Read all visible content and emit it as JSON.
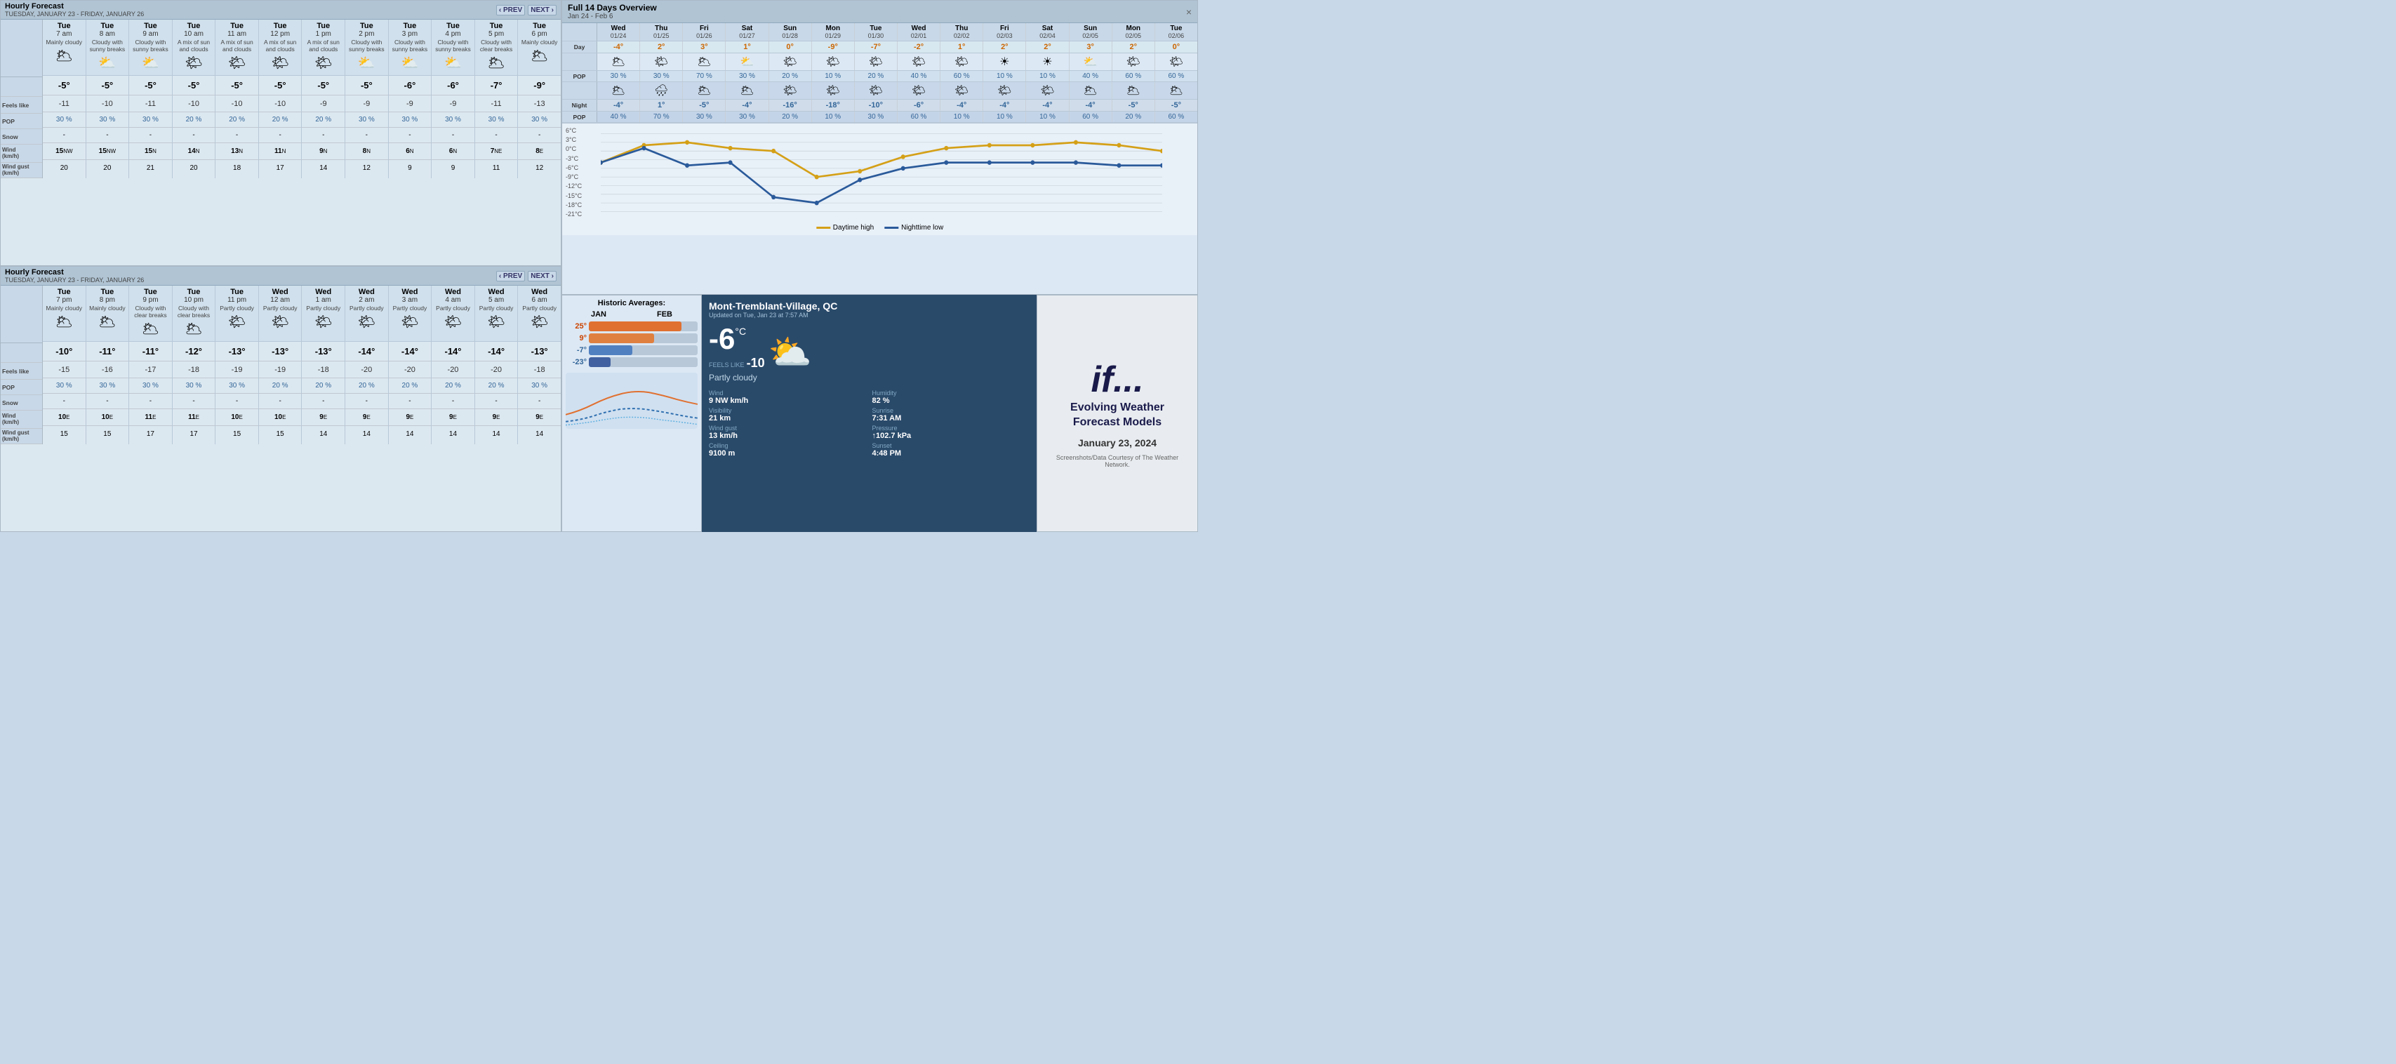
{
  "top_left": {
    "title": "Hourly Forecast",
    "subtitle": "TUESDAY, JANUARY 23 - FRIDAY, JANUARY 26",
    "prev": "‹ PREV",
    "next": "NEXT ›",
    "side_labels": [
      {
        "text": "",
        "type": "spacer"
      },
      {
        "text": "Feels like",
        "type": "feels"
      },
      {
        "text": "POP",
        "type": "pop"
      },
      {
        "text": "Snow",
        "type": "snow"
      },
      {
        "text": "Wind (km/h)",
        "type": "wind"
      },
      {
        "text": "Wind gust (km/h)",
        "type": "gust"
      }
    ],
    "hours": [
      {
        "day": "Tue",
        "time": "7 am",
        "desc": "Mainly cloudy",
        "icon": "🌥",
        "temp": "-5°",
        "feels": "-11",
        "pop": "30",
        "snow": "-",
        "wind": "15",
        "wind_dir": "NW",
        "gust": "20"
      },
      {
        "day": "Tue",
        "time": "8 am",
        "desc": "Cloudy with sunny breaks",
        "icon": "⛅",
        "temp": "-5°",
        "feels": "-10",
        "pop": "30",
        "snow": "-",
        "wind": "15",
        "wind_dir": "NW",
        "gust": "20"
      },
      {
        "day": "Tue",
        "time": "9 am",
        "desc": "Cloudy with sunny breaks",
        "icon": "⛅",
        "temp": "-5°",
        "feels": "-11",
        "pop": "30",
        "snow": "-",
        "wind": "15",
        "wind_dir": "N",
        "gust": "21"
      },
      {
        "day": "Tue",
        "time": "10 am",
        "desc": "A mix of sun and clouds",
        "icon": "🌤",
        "temp": "-5°",
        "feels": "-10",
        "pop": "20",
        "snow": "-",
        "wind": "14",
        "wind_dir": "N",
        "gust": "20"
      },
      {
        "day": "Tue",
        "time": "11 am",
        "desc": "A mix of sun and clouds",
        "icon": "🌤",
        "temp": "-5°",
        "feels": "-10",
        "pop": "20",
        "snow": "-",
        "wind": "13",
        "wind_dir": "N",
        "gust": "18"
      },
      {
        "day": "Tue",
        "time": "12 pm",
        "desc": "A mix of sun and clouds",
        "icon": "🌤",
        "temp": "-5°",
        "feels": "-10",
        "pop": "20",
        "snow": "-",
        "wind": "11",
        "wind_dir": "N",
        "gust": "17"
      },
      {
        "day": "Tue",
        "time": "1 pm",
        "desc": "A mix of sun and clouds",
        "icon": "🌤",
        "temp": "-5°",
        "feels": "-9",
        "pop": "20",
        "snow": "-",
        "wind": "9",
        "wind_dir": "N",
        "gust": "14"
      },
      {
        "day": "Tue",
        "time": "2 pm",
        "desc": "Cloudy with sunny breaks",
        "icon": "⛅",
        "temp": "-5°",
        "feels": "-9",
        "pop": "30",
        "snow": "-",
        "wind": "8",
        "wind_dir": "N",
        "gust": "12"
      },
      {
        "day": "Tue",
        "time": "3 pm",
        "desc": "Cloudy with sunny breaks",
        "icon": "⛅",
        "temp": "-6°",
        "feels": "-9",
        "pop": "30",
        "snow": "-",
        "wind": "6",
        "wind_dir": "N",
        "gust": "9"
      },
      {
        "day": "Tue",
        "time": "4 pm",
        "desc": "Cloudy with sunny breaks",
        "icon": "⛅",
        "temp": "-6°",
        "feels": "-9",
        "pop": "30",
        "snow": "-",
        "wind": "6",
        "wind_dir": "N",
        "gust": "9"
      },
      {
        "day": "Tue",
        "time": "5 pm",
        "desc": "Cloudy with clear breaks",
        "icon": "🌥",
        "temp": "-7°",
        "feels": "-11",
        "pop": "30",
        "snow": "-",
        "wind": "7",
        "wind_dir": "NE",
        "gust": "11"
      },
      {
        "day": "Tue",
        "time": "6 pm",
        "desc": "Mainly cloudy",
        "icon": "🌥",
        "temp": "-9°",
        "feels": "-13",
        "pop": "30",
        "snow": "-",
        "wind": "8",
        "wind_dir": "E",
        "gust": "12"
      }
    ]
  },
  "top_right_hourly": {
    "title": "Hourly Forecast",
    "subtitle": "TUESDAY, JANUARY 23 - FRIDAY, JANUARY 26",
    "prev": "‹ PREV",
    "next": "NEXT ›",
    "hours": [
      {
        "day": "Tue",
        "time": "7 pm",
        "desc": "Mainly cloudy",
        "icon": "🌥",
        "temp": "-10°",
        "feels": "-15",
        "pop": "30",
        "snow": "-",
        "wind": "10",
        "wind_dir": "E",
        "gust": "15"
      },
      {
        "day": "Tue",
        "time": "8 pm",
        "desc": "Mainly cloudy",
        "icon": "🌥",
        "temp": "-11°",
        "feels": "-16",
        "pop": "30",
        "snow": "-",
        "wind": "10",
        "wind_dir": "E",
        "gust": "15"
      },
      {
        "day": "Tue",
        "time": "9 pm",
        "desc": "Cloudy with clear breaks",
        "icon": "🌥",
        "temp": "-11°",
        "feels": "-17",
        "pop": "30",
        "snow": "-",
        "wind": "11",
        "wind_dir": "E",
        "gust": "17"
      },
      {
        "day": "Tue",
        "time": "10 pm",
        "desc": "Cloudy with clear breaks",
        "icon": "🌥",
        "temp": "-12°",
        "feels": "-18",
        "pop": "30",
        "snow": "-",
        "wind": "11",
        "wind_dir": "E",
        "gust": "17"
      },
      {
        "day": "Tue",
        "time": "11 pm",
        "desc": "Partly cloudy",
        "icon": "🌤",
        "temp": "-13°",
        "feels": "-19",
        "pop": "30",
        "snow": "-",
        "wind": "10",
        "wind_dir": "E",
        "gust": "15"
      },
      {
        "day": "Wed",
        "time": "12 am",
        "desc": "Partly cloudy",
        "icon": "🌤",
        "temp": "-13°",
        "feels": "-19",
        "pop": "20",
        "snow": "-",
        "wind": "10",
        "wind_dir": "E",
        "gust": "15"
      },
      {
        "day": "Wed",
        "time": "1 am",
        "desc": "Partly cloudy",
        "icon": "🌤",
        "temp": "-13°",
        "feels": "-18",
        "pop": "20",
        "snow": "-",
        "wind": "9",
        "wind_dir": "E",
        "gust": "14"
      },
      {
        "day": "Wed",
        "time": "2 am",
        "desc": "Partly cloudy",
        "icon": "🌤",
        "temp": "-14°",
        "feels": "-20",
        "pop": "20",
        "snow": "-",
        "wind": "9",
        "wind_dir": "E",
        "gust": "14"
      },
      {
        "day": "Wed",
        "time": "3 am",
        "desc": "Partly cloudy",
        "icon": "🌤",
        "temp": "-14°",
        "feels": "-20",
        "pop": "20",
        "snow": "-",
        "wind": "9",
        "wind_dir": "E",
        "gust": "14"
      },
      {
        "day": "Wed",
        "time": "4 am",
        "desc": "Partly cloudy",
        "icon": "🌤",
        "temp": "-14°",
        "feels": "-20",
        "pop": "20",
        "snow": "-",
        "wind": "9",
        "wind_dir": "E",
        "gust": "14"
      },
      {
        "day": "Wed",
        "time": "5 am",
        "desc": "Partly cloudy",
        "icon": "🌤",
        "temp": "-14°",
        "feels": "-20",
        "pop": "20",
        "snow": "-",
        "wind": "9",
        "wind_dir": "E",
        "gust": "14"
      },
      {
        "day": "Wed",
        "time": "6 am",
        "desc": "Partly cloudy",
        "icon": "🌤",
        "temp": "-13°",
        "feels": "-18",
        "pop": "30",
        "snow": "-",
        "wind": "9",
        "wind_dir": "E",
        "gust": "14"
      }
    ]
  },
  "overview": {
    "title": "Full 14 Days Overview",
    "date_range": "Jan 24 - Feb 6",
    "days": [
      {
        "name": "Wed",
        "date": "01/24",
        "icon": "🌥",
        "day_temp": "-4°",
        "pop_day": "30 %",
        "night_icon": "🌥",
        "night_temp": "-4°",
        "pop_night": "40 %"
      },
      {
        "name": "Thu",
        "date": "01/25",
        "icon": "🌤",
        "day_temp": "2°",
        "pop_day": "30 %",
        "night_icon": "🌧",
        "night_temp": "1°",
        "pop_night": "70 %"
      },
      {
        "name": "Fri",
        "date": "01/26",
        "icon": "🌥",
        "day_temp": "3°",
        "pop_day": "70 %",
        "night_icon": "🌥",
        "night_temp": "-5°",
        "pop_night": "30 %"
      },
      {
        "name": "Sat",
        "date": "01/27",
        "icon": "⛅",
        "day_temp": "1°",
        "pop_day": "30 %",
        "night_icon": "🌥",
        "night_temp": "-4°",
        "pop_night": "30 %"
      },
      {
        "name": "Sun",
        "date": "01/28",
        "icon": "🌤",
        "day_temp": "0°",
        "pop_day": "20 %",
        "night_icon": "🌤",
        "night_temp": "-16°",
        "pop_night": "20 %"
      },
      {
        "name": "Mon",
        "date": "01/29",
        "icon": "🌤",
        "day_temp": "-9°",
        "pop_day": "10 %",
        "night_icon": "🌤",
        "night_temp": "-18°",
        "pop_night": "10 %"
      },
      {
        "name": "Tue",
        "date": "01/30",
        "icon": "🌤",
        "day_temp": "-7°",
        "pop_day": "20 %",
        "night_icon": "🌤",
        "night_temp": "-10°",
        "pop_night": "30 %"
      },
      {
        "name": "Wed",
        "date": "02/01",
        "icon": "🌤",
        "day_temp": "-2°",
        "pop_day": "40 %",
        "night_icon": "🌤",
        "night_temp": "-6°",
        "pop_night": "60 %"
      },
      {
        "name": "Thu",
        "date": "02/02",
        "icon": "🌤",
        "day_temp": "1°",
        "pop_day": "60 %",
        "night_icon": "🌤",
        "night_temp": "-4°",
        "pop_night": "10 %"
      },
      {
        "name": "Fri",
        "date": "02/03",
        "icon": "☀",
        "day_temp": "2°",
        "pop_day": "10 %",
        "night_icon": "🌤",
        "night_temp": "-4°",
        "pop_night": "10 %"
      },
      {
        "name": "Sat",
        "date": "02/04",
        "icon": "☀",
        "day_temp": "2°",
        "pop_day": "10 %",
        "night_icon": "🌤",
        "night_temp": "-4°",
        "pop_night": "10 %"
      },
      {
        "name": "Sun",
        "date": "02/05",
        "icon": "⛅",
        "day_temp": "3°",
        "pop_day": "40 %",
        "night_icon": "🌥",
        "night_temp": "-4°",
        "pop_night": "60 %"
      },
      {
        "name": "Mon",
        "date": "02/05",
        "icon": "🌤",
        "day_temp": "2°",
        "pop_day": "60 %",
        "night_icon": "🌥",
        "night_temp": "-5°",
        "pop_night": "20 %"
      },
      {
        "name": "Tue",
        "date": "02/06",
        "icon": "🌤",
        "day_temp": "0°",
        "pop_day": "60 %",
        "night_icon": "🌥",
        "night_temp": "-5°",
        "pop_night": "60 %"
      }
    ],
    "chart": {
      "y_labels": [
        "6°C",
        "3°C",
        "0°C",
        "-3°C",
        "-6°C",
        "-9°C",
        "-12°C",
        "-15°C",
        "-18°C",
        "-21°C"
      ],
      "daytime_color": "#d4a017",
      "nighttime_color": "#2a5a9a",
      "legend_day": "Daytime high",
      "legend_night": "Nighttime low"
    }
  },
  "historic": {
    "title": "Historic Averages:",
    "months": [
      "JAN",
      "FEB"
    ],
    "bars": [
      {
        "label": "25°",
        "jan_pct": 85,
        "feb_pct": 80,
        "color": "#e07030"
      },
      {
        "label": "9°",
        "jan_pct": 60,
        "feb_pct": 55,
        "color": "#e08040"
      },
      {
        "label": "-7°",
        "jan_pct": 40,
        "feb_pct": 45,
        "color": "#5080c0"
      },
      {
        "label": "-23°",
        "jan_pct": 20,
        "feb_pct": 25,
        "color": "#4060a0"
      }
    ]
  },
  "current": {
    "location": "Mont-Tremblant-Village, QC",
    "updated": "Updated on Tue, Jan 23 at 7:57 AM",
    "temp": "-6",
    "temp_unit": "°C",
    "feels_like_label": "FEELS LIKE",
    "feels_like": "-10",
    "desc": "Partly cloudy",
    "icon": "⛅",
    "details": [
      {
        "label": "Wind",
        "value": "9 NW km/h"
      },
      {
        "label": "Humidity",
        "value": "82 %"
      },
      {
        "label": "Visibility",
        "value": "21 km"
      },
      {
        "label": "Sunrise",
        "value": "7:31 AM"
      },
      {
        "label": "Wind gust",
        "value": "13 km/h"
      },
      {
        "label": "Pressure",
        "value": "↑102.7 kPa"
      },
      {
        "label": "Ceiling",
        "value": "9100 m"
      },
      {
        "label": "Sunset",
        "value": "4:48 PM"
      }
    ]
  },
  "brand": {
    "name": "if...",
    "tagline": "Evolving Weather Forecast Models",
    "date": "January 23, 2024",
    "screenshot_credit": "Screenshots/Data Courtesy of The Weather Network."
  }
}
